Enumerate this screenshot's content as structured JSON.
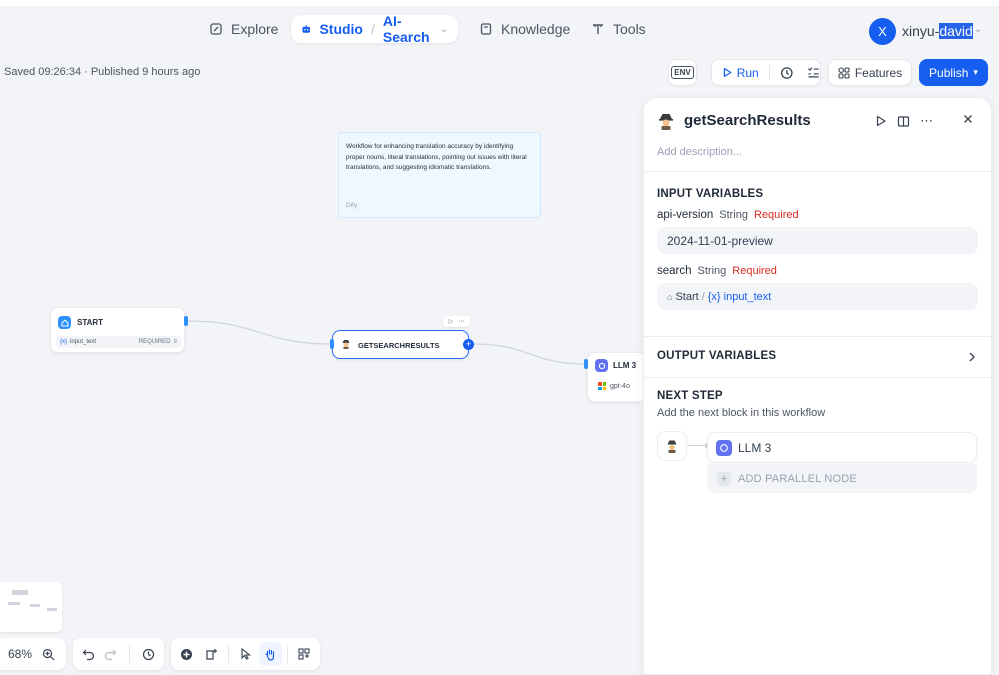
{
  "nav": {
    "explore": "Explore",
    "studio": "Studio",
    "studio_sep": "/",
    "app_name": "AI-Search",
    "knowledge": "Knowledge",
    "tools": "Tools",
    "avatar_letter": "X",
    "user_prefix": "xinyu-",
    "user_selected": "david"
  },
  "status": {
    "saved": "Saved 09:26:34 · Published 9 hours ago"
  },
  "toolbar": {
    "env": "ENV",
    "run": "Run",
    "features": "Features",
    "publish": "Publish"
  },
  "note": {
    "text": "Workflow for enhancing translation accuracy by identifying proper nouns, literal translations, pointing out issues with literal translations, and suggesting idiomatic translations.",
    "author": "Dify"
  },
  "nodes": {
    "start": {
      "title": "START",
      "var_prefix": "{x}",
      "var_name": "input_text",
      "var_required": "REQUIRED"
    },
    "search": {
      "title": "GETSEARCHRESULTS"
    },
    "llm": {
      "title": "LLM 3",
      "model": "gpt-4o"
    }
  },
  "zoom": {
    "level": "68%"
  },
  "panel": {
    "title": "getSearchResults",
    "add_description": "Add description...",
    "input_section": "INPUT VARIABLES",
    "inputs": [
      {
        "name": "api-version",
        "type": "String",
        "required": "Required",
        "value": "2024-11-01-preview"
      },
      {
        "name": "search",
        "type": "String",
        "required": "Required",
        "ref_node": "Start",
        "ref_sep": "/",
        "ref_var": "{x} input_text"
      }
    ],
    "output_section": "OUTPUT VARIABLES",
    "next_step_title": "NEXT STEP",
    "next_step_subtitle": "Add the next block in this workflow",
    "next_node": "LLM 3",
    "add_parallel": "ADD PARALLEL NODE"
  },
  "colors": {
    "accent": "#155eef",
    "required": "#d92d20",
    "llm_icon": "#6172f3",
    "start_icon": "#2e90fa"
  }
}
